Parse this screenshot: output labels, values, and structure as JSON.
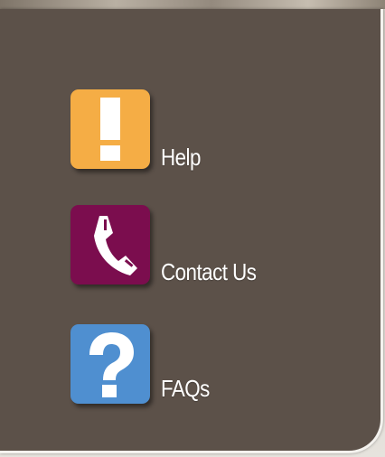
{
  "menu": {
    "items": [
      {
        "label": "Help",
        "icon": "exclamation-icon",
        "color": "#f5ad45"
      },
      {
        "label": "Contact Us",
        "icon": "phone-icon",
        "color": "#7b0d4e"
      },
      {
        "label": "FAQs",
        "icon": "question-mark-icon",
        "color": "#4f8fd0"
      }
    ]
  },
  "panel": {
    "background": "#5c5149",
    "border": "#f4f2ee"
  }
}
